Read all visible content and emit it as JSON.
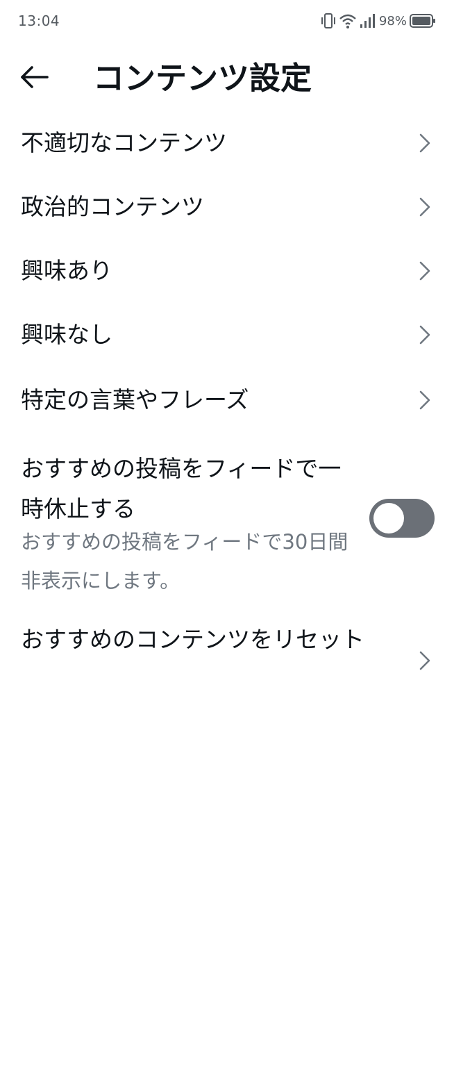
{
  "status_bar": {
    "time": "13:04",
    "battery": "98%",
    "icons": [
      "vibrate-icon",
      "wifi-icon",
      "signal-icon",
      "battery-icon"
    ]
  },
  "header": {
    "back_icon": "arrow-left-icon",
    "title": "コンテンツ設定"
  },
  "menu": {
    "items": [
      {
        "label": "不適切なコンテンツ"
      },
      {
        "label": "政治的コンテンツ"
      },
      {
        "label": "興味あり"
      },
      {
        "label": "興味なし"
      },
      {
        "label": "特定の言葉やフレーズ"
      }
    ]
  },
  "toggle": {
    "title": "おすすめの投稿をフィードで一時休止する",
    "description": "おすすめの投稿をフィードで30日間非表示にします。",
    "state": "off"
  },
  "reset": {
    "label": "おすすめのコンテンツをリセット"
  },
  "colors": {
    "text_primary": "#0f1419",
    "text_secondary": "#6f7780",
    "toggle_track": "#6b7077",
    "background": "#ffffff"
  }
}
